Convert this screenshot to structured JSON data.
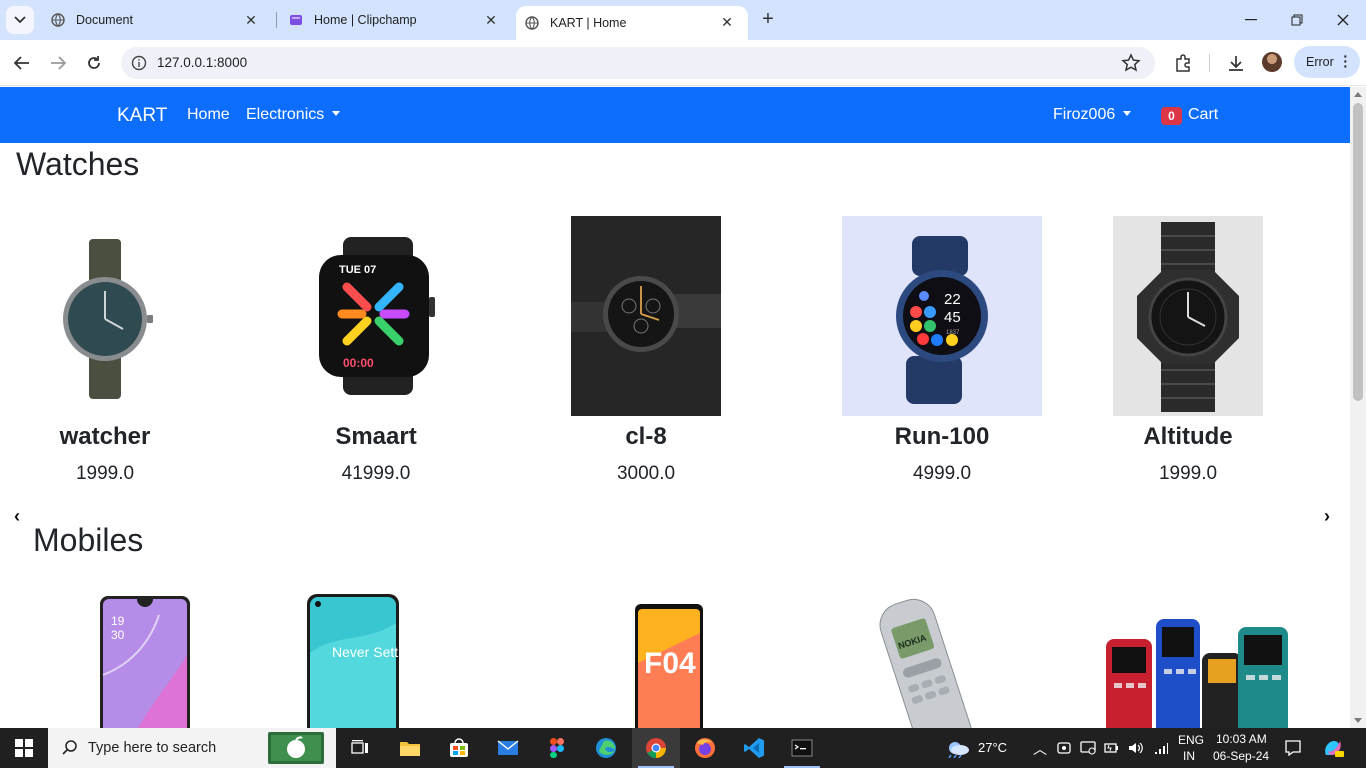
{
  "browser": {
    "tabs": [
      {
        "title": "Document",
        "icon": "globe-icon",
        "active": false
      },
      {
        "title": "Home | Clipchamp",
        "icon": "clipchamp-icon",
        "active": false
      },
      {
        "title": "KART | Home",
        "icon": "globe-icon",
        "active": true
      }
    ],
    "url": "127.0.0.1:8000",
    "profile_status": "Error"
  },
  "navbar": {
    "brand": "KART",
    "links": [
      "Home",
      "Electronics"
    ],
    "user": "Firoz006",
    "cart_count": "0",
    "cart_label": "Cart"
  },
  "sections": [
    {
      "title": "Watches",
      "products": [
        {
          "name": "watcher",
          "price": "1999.0"
        },
        {
          "name": "Smaart",
          "price": "41999.0"
        },
        {
          "name": "cl-8",
          "price": "3000.0"
        },
        {
          "name": "Run-100",
          "price": "4999.0"
        },
        {
          "name": "Altitude",
          "price": "1999.0"
        }
      ]
    },
    {
      "title": "Mobiles",
      "products": []
    }
  ],
  "watch_faces": {
    "smart_date": "TUE 07",
    "smart_time": "00:00",
    "run_time_h": "22",
    "run_time_m": "45",
    "run_step": "1837"
  },
  "mobile_screens": {
    "phone1_time_h": "19",
    "phone1_time_m": "30",
    "phone2_text": "Never Settle",
    "phone3_text": "F04",
    "phone4_text": "NOKIA"
  },
  "taskbar": {
    "search_placeholder": "Type here to search",
    "weather": "27°C",
    "language": "ENG",
    "region": "IN",
    "time": "10:03 AM",
    "date": "06-Sep-24"
  },
  "colors": {
    "navbar": "#0d6efd",
    "badge": "#dc3545",
    "tabstrip": "#d3e3fd",
    "taskbar": "#202020"
  }
}
